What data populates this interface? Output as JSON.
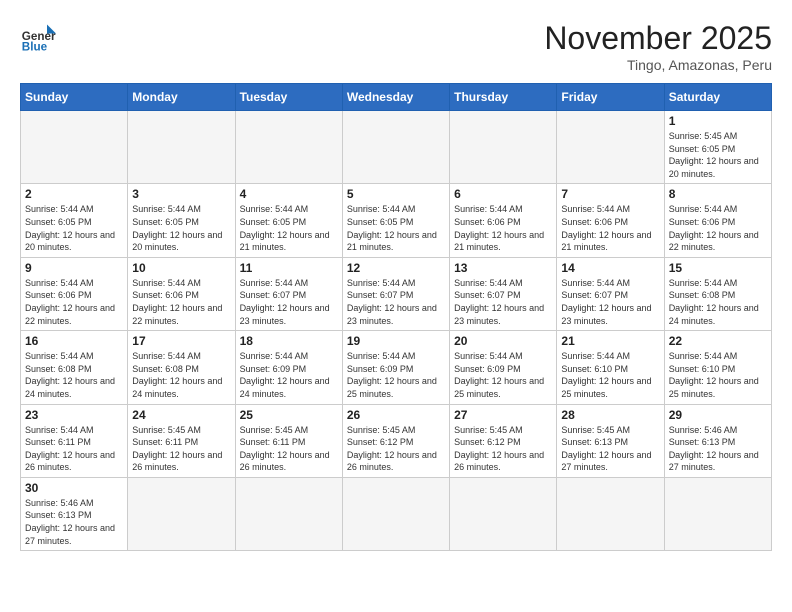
{
  "header": {
    "logo_general": "General",
    "logo_blue": "Blue",
    "month_title": "November 2025",
    "location": "Tingo, Amazonas, Peru"
  },
  "days_of_week": [
    "Sunday",
    "Monday",
    "Tuesday",
    "Wednesday",
    "Thursday",
    "Friday",
    "Saturday"
  ],
  "weeks": [
    [
      {
        "day": "",
        "info": ""
      },
      {
        "day": "",
        "info": ""
      },
      {
        "day": "",
        "info": ""
      },
      {
        "day": "",
        "info": ""
      },
      {
        "day": "",
        "info": ""
      },
      {
        "day": "",
        "info": ""
      },
      {
        "day": "1",
        "info": "Sunrise: 5:45 AM\nSunset: 6:05 PM\nDaylight: 12 hours and 20 minutes."
      }
    ],
    [
      {
        "day": "2",
        "info": "Sunrise: 5:44 AM\nSunset: 6:05 PM\nDaylight: 12 hours and 20 minutes."
      },
      {
        "day": "3",
        "info": "Sunrise: 5:44 AM\nSunset: 6:05 PM\nDaylight: 12 hours and 20 minutes."
      },
      {
        "day": "4",
        "info": "Sunrise: 5:44 AM\nSunset: 6:05 PM\nDaylight: 12 hours and 21 minutes."
      },
      {
        "day": "5",
        "info": "Sunrise: 5:44 AM\nSunset: 6:05 PM\nDaylight: 12 hours and 21 minutes."
      },
      {
        "day": "6",
        "info": "Sunrise: 5:44 AM\nSunset: 6:06 PM\nDaylight: 12 hours and 21 minutes."
      },
      {
        "day": "7",
        "info": "Sunrise: 5:44 AM\nSunset: 6:06 PM\nDaylight: 12 hours and 21 minutes."
      },
      {
        "day": "8",
        "info": "Sunrise: 5:44 AM\nSunset: 6:06 PM\nDaylight: 12 hours and 22 minutes."
      }
    ],
    [
      {
        "day": "9",
        "info": "Sunrise: 5:44 AM\nSunset: 6:06 PM\nDaylight: 12 hours and 22 minutes."
      },
      {
        "day": "10",
        "info": "Sunrise: 5:44 AM\nSunset: 6:06 PM\nDaylight: 12 hours and 22 minutes."
      },
      {
        "day": "11",
        "info": "Sunrise: 5:44 AM\nSunset: 6:07 PM\nDaylight: 12 hours and 23 minutes."
      },
      {
        "day": "12",
        "info": "Sunrise: 5:44 AM\nSunset: 6:07 PM\nDaylight: 12 hours and 23 minutes."
      },
      {
        "day": "13",
        "info": "Sunrise: 5:44 AM\nSunset: 6:07 PM\nDaylight: 12 hours and 23 minutes."
      },
      {
        "day": "14",
        "info": "Sunrise: 5:44 AM\nSunset: 6:07 PM\nDaylight: 12 hours and 23 minutes."
      },
      {
        "day": "15",
        "info": "Sunrise: 5:44 AM\nSunset: 6:08 PM\nDaylight: 12 hours and 24 minutes."
      }
    ],
    [
      {
        "day": "16",
        "info": "Sunrise: 5:44 AM\nSunset: 6:08 PM\nDaylight: 12 hours and 24 minutes."
      },
      {
        "day": "17",
        "info": "Sunrise: 5:44 AM\nSunset: 6:08 PM\nDaylight: 12 hours and 24 minutes."
      },
      {
        "day": "18",
        "info": "Sunrise: 5:44 AM\nSunset: 6:09 PM\nDaylight: 12 hours and 24 minutes."
      },
      {
        "day": "19",
        "info": "Sunrise: 5:44 AM\nSunset: 6:09 PM\nDaylight: 12 hours and 25 minutes."
      },
      {
        "day": "20",
        "info": "Sunrise: 5:44 AM\nSunset: 6:09 PM\nDaylight: 12 hours and 25 minutes."
      },
      {
        "day": "21",
        "info": "Sunrise: 5:44 AM\nSunset: 6:10 PM\nDaylight: 12 hours and 25 minutes."
      },
      {
        "day": "22",
        "info": "Sunrise: 5:44 AM\nSunset: 6:10 PM\nDaylight: 12 hours and 25 minutes."
      }
    ],
    [
      {
        "day": "23",
        "info": "Sunrise: 5:44 AM\nSunset: 6:11 PM\nDaylight: 12 hours and 26 minutes."
      },
      {
        "day": "24",
        "info": "Sunrise: 5:45 AM\nSunset: 6:11 PM\nDaylight: 12 hours and 26 minutes."
      },
      {
        "day": "25",
        "info": "Sunrise: 5:45 AM\nSunset: 6:11 PM\nDaylight: 12 hours and 26 minutes."
      },
      {
        "day": "26",
        "info": "Sunrise: 5:45 AM\nSunset: 6:12 PM\nDaylight: 12 hours and 26 minutes."
      },
      {
        "day": "27",
        "info": "Sunrise: 5:45 AM\nSunset: 6:12 PM\nDaylight: 12 hours and 26 minutes."
      },
      {
        "day": "28",
        "info": "Sunrise: 5:45 AM\nSunset: 6:13 PM\nDaylight: 12 hours and 27 minutes."
      },
      {
        "day": "29",
        "info": "Sunrise: 5:46 AM\nSunset: 6:13 PM\nDaylight: 12 hours and 27 minutes."
      }
    ],
    [
      {
        "day": "30",
        "info": "Sunrise: 5:46 AM\nSunset: 6:13 PM\nDaylight: 12 hours and 27 minutes."
      },
      {
        "day": "",
        "info": ""
      },
      {
        "day": "",
        "info": ""
      },
      {
        "day": "",
        "info": ""
      },
      {
        "day": "",
        "info": ""
      },
      {
        "day": "",
        "info": ""
      },
      {
        "day": "",
        "info": ""
      }
    ]
  ]
}
